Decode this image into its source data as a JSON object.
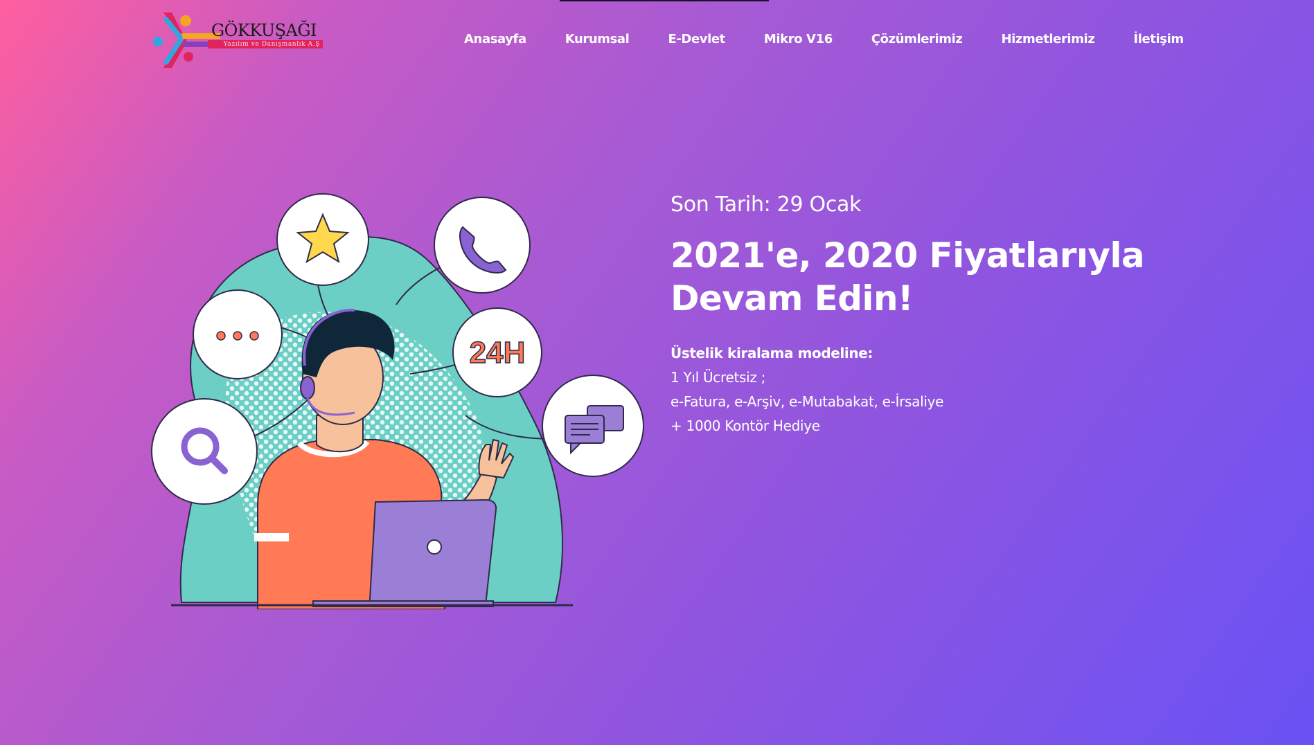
{
  "brand": {
    "name": "GÖKKUŞAĞI",
    "tagline": "Yazılım ve Danışmanlık A.Ş"
  },
  "nav": {
    "items": [
      {
        "label": "Anasayfa"
      },
      {
        "label": "Kurumsal"
      },
      {
        "label": "E-Devlet"
      },
      {
        "label": "Mikro V16"
      },
      {
        "label": "Çözümlerimiz"
      },
      {
        "label": "Hizmetlerimiz"
      },
      {
        "label": "İletişim"
      }
    ]
  },
  "hero": {
    "deadline": "Son Tarih: 29 Ocak",
    "headline_line1": "2021'e, 2020 Fiyatlarıyla",
    "headline_line2": "Devam Edin!",
    "offer_title": "Üstelik kiralama modeline:",
    "offer_lines": [
      "1 Yıl Ücretsiz ;",
      "e-Fatura, e-Arşiv, e-Mutabakat, e-İrsaliye",
      "+ 1000 Kontör Hediye"
    ]
  },
  "illustration": {
    "bubble_24h_text": "24H",
    "icons": [
      "star-icon",
      "phone-icon",
      "dots-icon",
      "24h-icon",
      "search-icon",
      "chat-icon"
    ]
  },
  "colors": {
    "gradient_start": "#ff5f9e",
    "gradient_end": "#6a52f4",
    "blob": "#6ccfc6",
    "shirt": "#ff7a55",
    "laptop": "#9b7fd6",
    "accent_purple": "#8a63d2",
    "star_yellow": "#ffd84d"
  }
}
